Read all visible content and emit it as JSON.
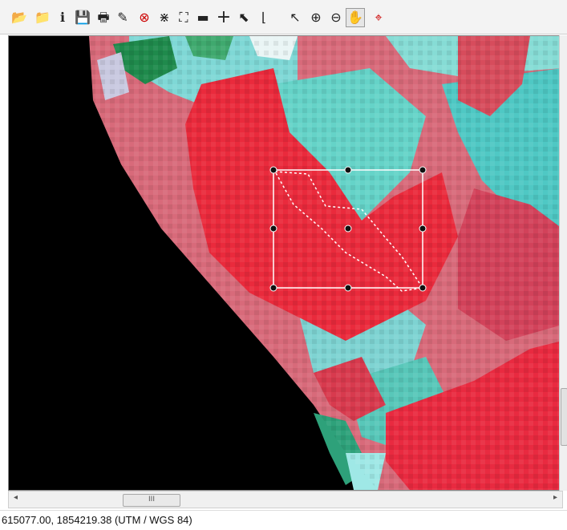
{
  "toolbar": {
    "buttons": [
      {
        "name": "open-folder-icon",
        "glyph": "📂"
      },
      {
        "name": "new-folder-icon",
        "glyph": "📁"
      },
      {
        "name": "info-icon",
        "glyph": "ℹ"
      },
      {
        "name": "save-icon",
        "glyph": "💾"
      },
      {
        "name": "print-icon",
        "glyph": "🖶"
      },
      {
        "name": "eraser-icon",
        "glyph": "✎"
      },
      {
        "name": "delete-icon",
        "glyph": "⊗"
      },
      {
        "name": "shrink-icon",
        "glyph": "⋇"
      },
      {
        "name": "fit-extent-icon",
        "glyph": "⛶"
      },
      {
        "name": "measure-icon",
        "glyph": "▬"
      },
      {
        "name": "crosshair-icon",
        "glyph": "+"
      },
      {
        "name": "edit-arrow-icon",
        "glyph": "⬉"
      },
      {
        "name": "profile-chart-icon",
        "glyph": "⌊"
      },
      {
        "name": "select-arrow-icon",
        "glyph": "↖"
      },
      {
        "name": "zoom-in-icon",
        "glyph": "⊕"
      },
      {
        "name": "zoom-out-icon",
        "glyph": "⊖"
      },
      {
        "name": "pan-hand-icon",
        "glyph": "✋"
      },
      {
        "name": "pixel-query-icon",
        "glyph": "⌖"
      }
    ]
  },
  "hscroll": {
    "left_arrow": "◂",
    "right_arrow": "▸",
    "thumb_grip": "III"
  },
  "status": {
    "coordinates": "615077.00, 1854219.38  (UTM / WGS 84)"
  },
  "colors": {
    "vegetation_red": "#ea2a3c",
    "cyan": "#5fd6cf",
    "nodata": "#000000",
    "selection": "#ffffff"
  }
}
